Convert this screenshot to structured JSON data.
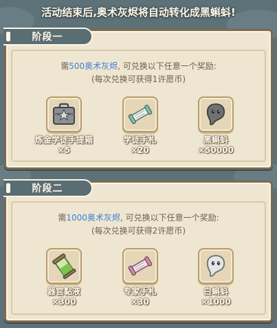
{
  "banner": {
    "text": "活动结束后,奥术灰烬将自动转化成黑蝌蚪!"
  },
  "stages": [
    {
      "title": "阶段一",
      "desc_pre": "需",
      "cost": "500奥术灰烬",
      "desc_post": ", 可兑换以下任意一个奖励:",
      "note": "(每次兑换可获得1许愿币)",
      "rewards": [
        {
          "name": "炼金学徒手提箱",
          "count": "×5",
          "icon": "briefcase-icon"
        },
        {
          "name": "学徒手札",
          "count": "×20",
          "icon": "scroll-icon"
        },
        {
          "name": "黑蝌蚪",
          "count": "×50000",
          "icon": "black-tadpole-icon"
        }
      ]
    },
    {
      "title": "阶段二",
      "desc_pre": "需",
      "cost": "1000奥术灰烬",
      "desc_post": ", 可兑换以下任意一个奖励:",
      "note": "(每次兑换可获得2许愿币)",
      "rewards": [
        {
          "name": "器官黏液",
          "count": "×300",
          "icon": "slime-vial-icon"
        },
        {
          "name": "专家手札",
          "count": "×30",
          "icon": "expert-scroll-icon"
        },
        {
          "name": "白蝌蚪",
          "count": "×1000",
          "icon": "white-tadpole-icon"
        }
      ]
    }
  ],
  "colors": {
    "background": "#5c7178",
    "panel": "#efe6d2",
    "highlight": "#3d7fd6",
    "tab": "#5a6d72"
  }
}
